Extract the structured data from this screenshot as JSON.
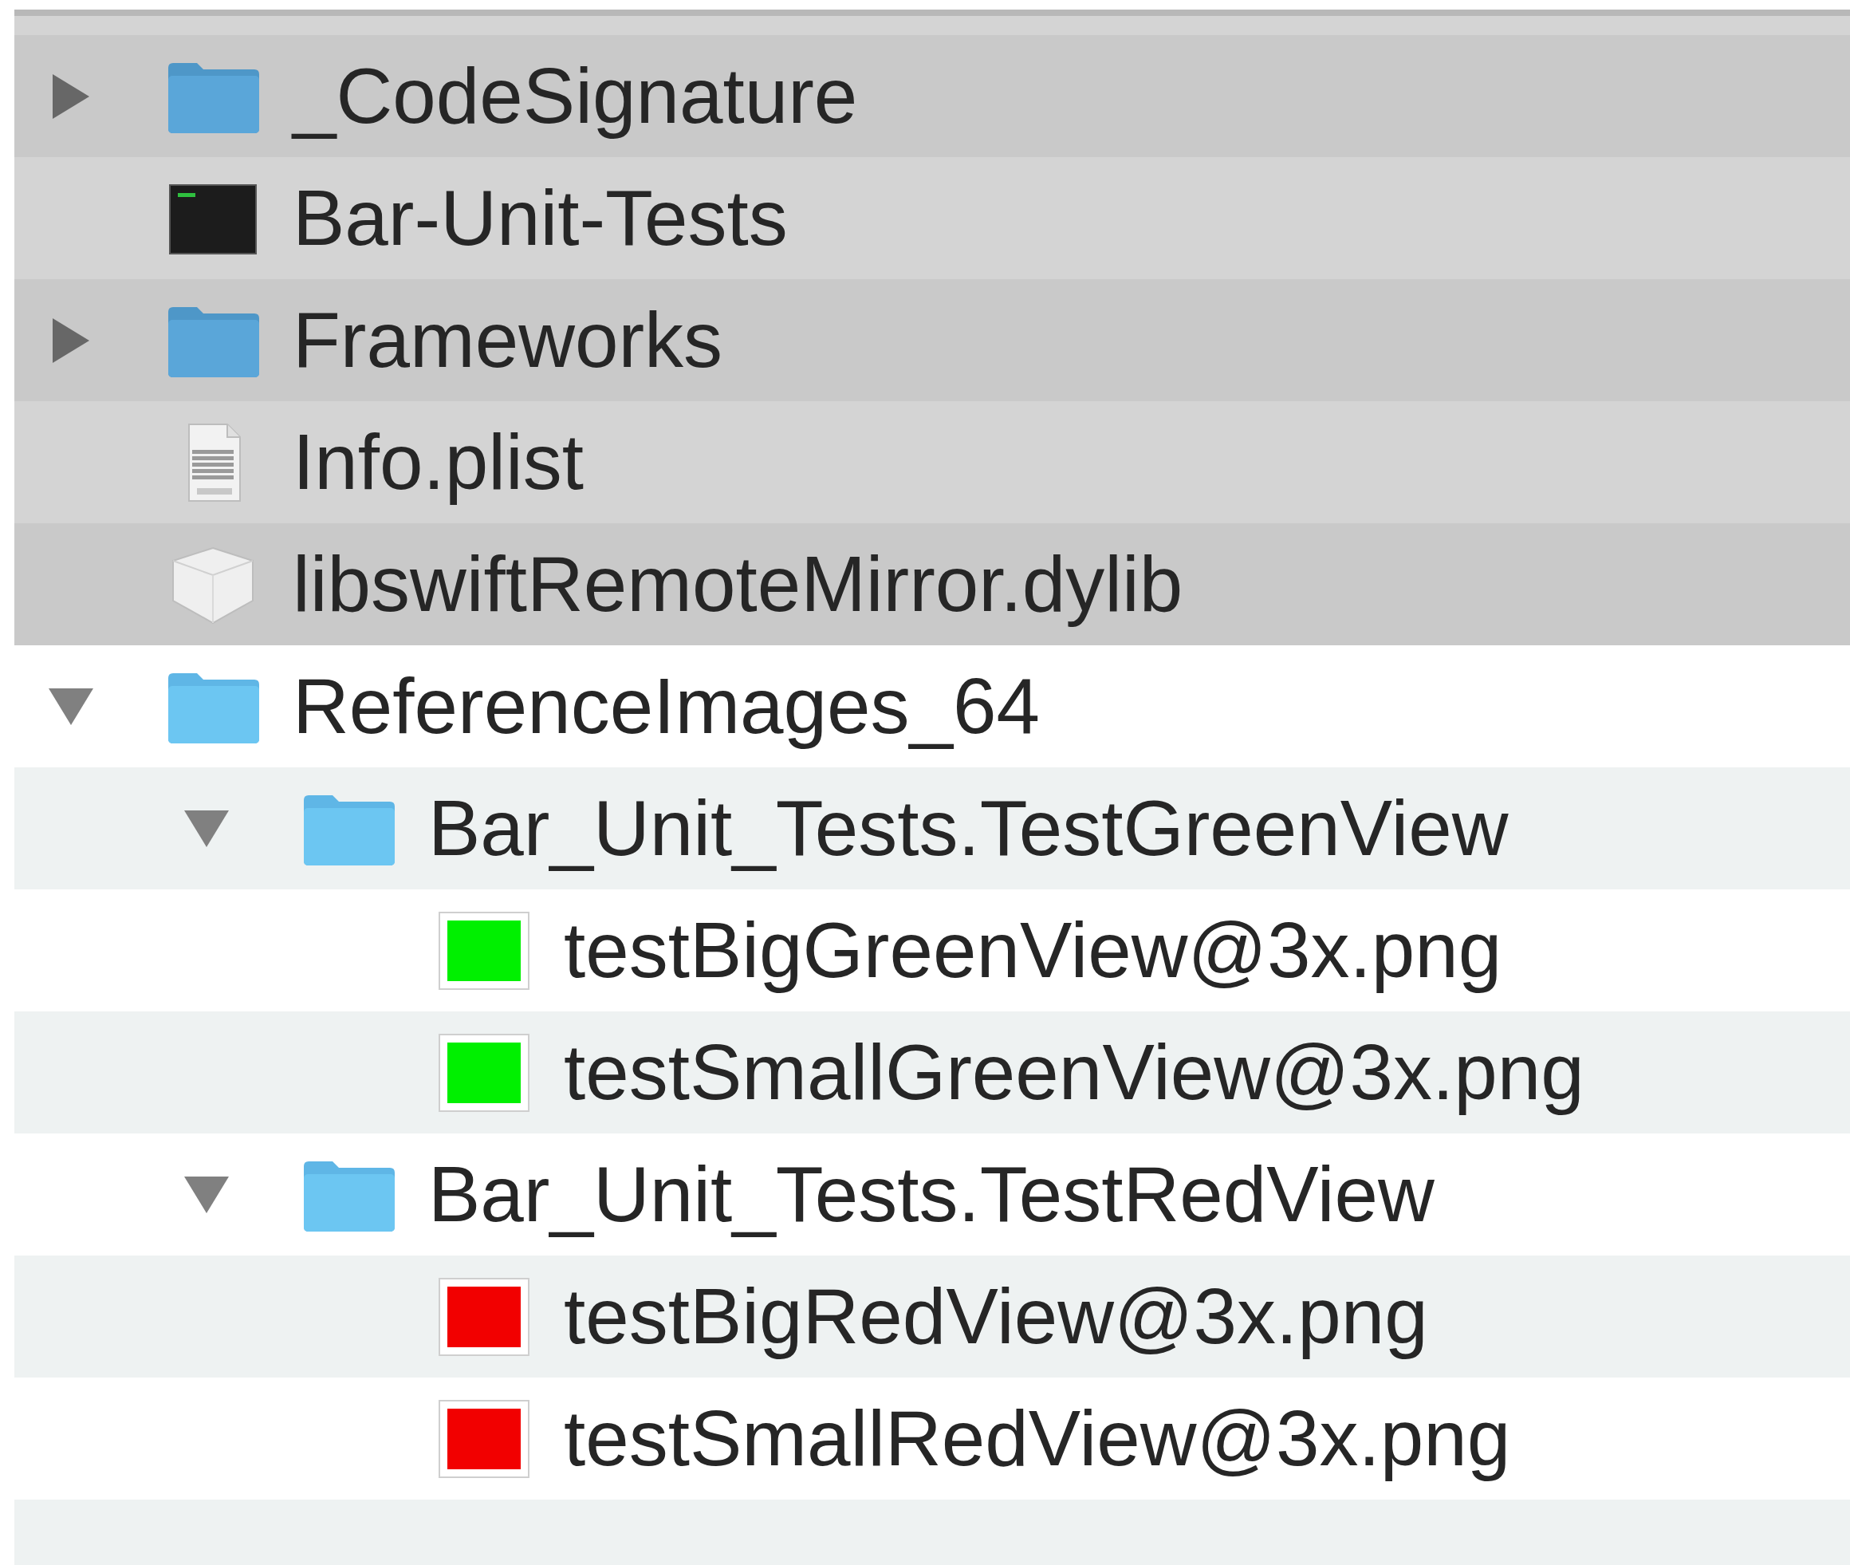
{
  "items": [
    {
      "kind": "folder",
      "name": "_CodeSignature",
      "selected": true,
      "expanded": false
    },
    {
      "kind": "executable",
      "name": "Bar-Unit-Tests",
      "selected": true
    },
    {
      "kind": "folder",
      "name": "Frameworks",
      "selected": true,
      "expanded": false
    },
    {
      "kind": "plist",
      "name": "Info.plist",
      "selected": true
    },
    {
      "kind": "dylib",
      "name": "libswiftRemoteMirror.dylib",
      "selected": true
    },
    {
      "kind": "folder",
      "name": "ReferenceImages_64",
      "selected": false,
      "expanded": true,
      "children": [
        {
          "kind": "folder",
          "name": "Bar_Unit_Tests.TestGreenView",
          "selected": false,
          "expanded": true,
          "children": [
            {
              "kind": "image",
              "name": "testBigGreenView@3x.png",
              "selected": false,
              "color": "#00f000"
            },
            {
              "kind": "image",
              "name": "testSmallGreenView@3x.png",
              "selected": false,
              "color": "#00f000"
            }
          ]
        },
        {
          "kind": "folder",
          "name": "Bar_Unit_Tests.TestRedView",
          "selected": false,
          "expanded": true,
          "children": [
            {
              "kind": "image",
              "name": "testBigRedView@3x.png",
              "selected": false,
              "color": "#f20000"
            },
            {
              "kind": "image",
              "name": "testSmallRedView@3x.png",
              "selected": false,
              "color": "#f20000"
            }
          ]
        }
      ]
    }
  ]
}
